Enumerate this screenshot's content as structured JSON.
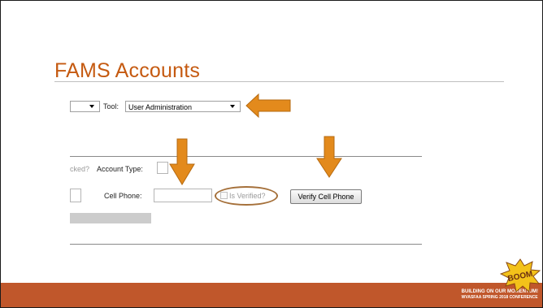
{
  "slide": {
    "title": "FAMS Accounts",
    "accent_color": "#c55a11",
    "footer_color": "#c0572b"
  },
  "toolbar": {
    "tool_label": "Tool:",
    "tool_value": "User Administration"
  },
  "form": {
    "locked_fragment": "cked?",
    "account_type_label": "Account Type:",
    "cell_phone_label": "Cell Phone:",
    "cell_phone_value": "",
    "is_verified_label": "Is Verified?",
    "verify_button_label": "Verify Cell Phone"
  },
  "footer": {
    "line1": "BUILDING ON OUR MOMENTUM!",
    "line2": "WVASFAA SPRING 2018 CONFERENCE"
  },
  "logo": {
    "text": "BOOM"
  },
  "icons": {
    "arrow": "arrow-icon",
    "dropdown": "chevron-down-icon",
    "checkbox": "checkbox-icon"
  }
}
